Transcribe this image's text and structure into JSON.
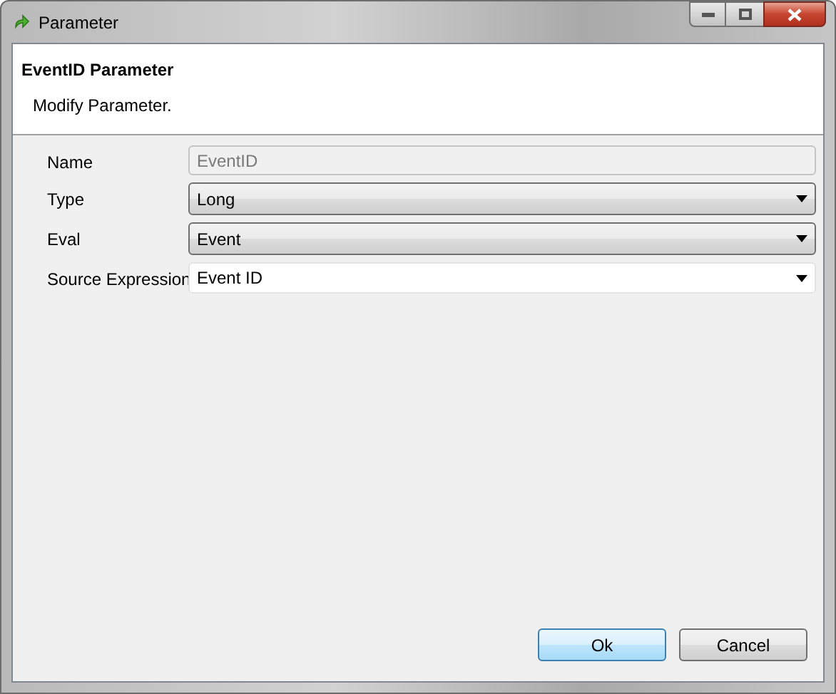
{
  "window": {
    "title": "Parameter"
  },
  "header": {
    "title": "EventID Parameter",
    "description": "Modify Parameter."
  },
  "fields": [
    {
      "label": "Name",
      "kind": "text",
      "value": "EventID",
      "disabled": true
    },
    {
      "label": "Type",
      "kind": "combo",
      "value": "Long",
      "disabled": false
    },
    {
      "label": "Eval",
      "kind": "combo",
      "value": "Event",
      "disabled": false
    },
    {
      "label": "Source Expression",
      "kind": "editable-combo",
      "value": "Event ID",
      "disabled": false
    }
  ],
  "buttons": [
    {
      "label": "Ok",
      "default": true
    },
    {
      "label": "Cancel",
      "default": false
    }
  ]
}
